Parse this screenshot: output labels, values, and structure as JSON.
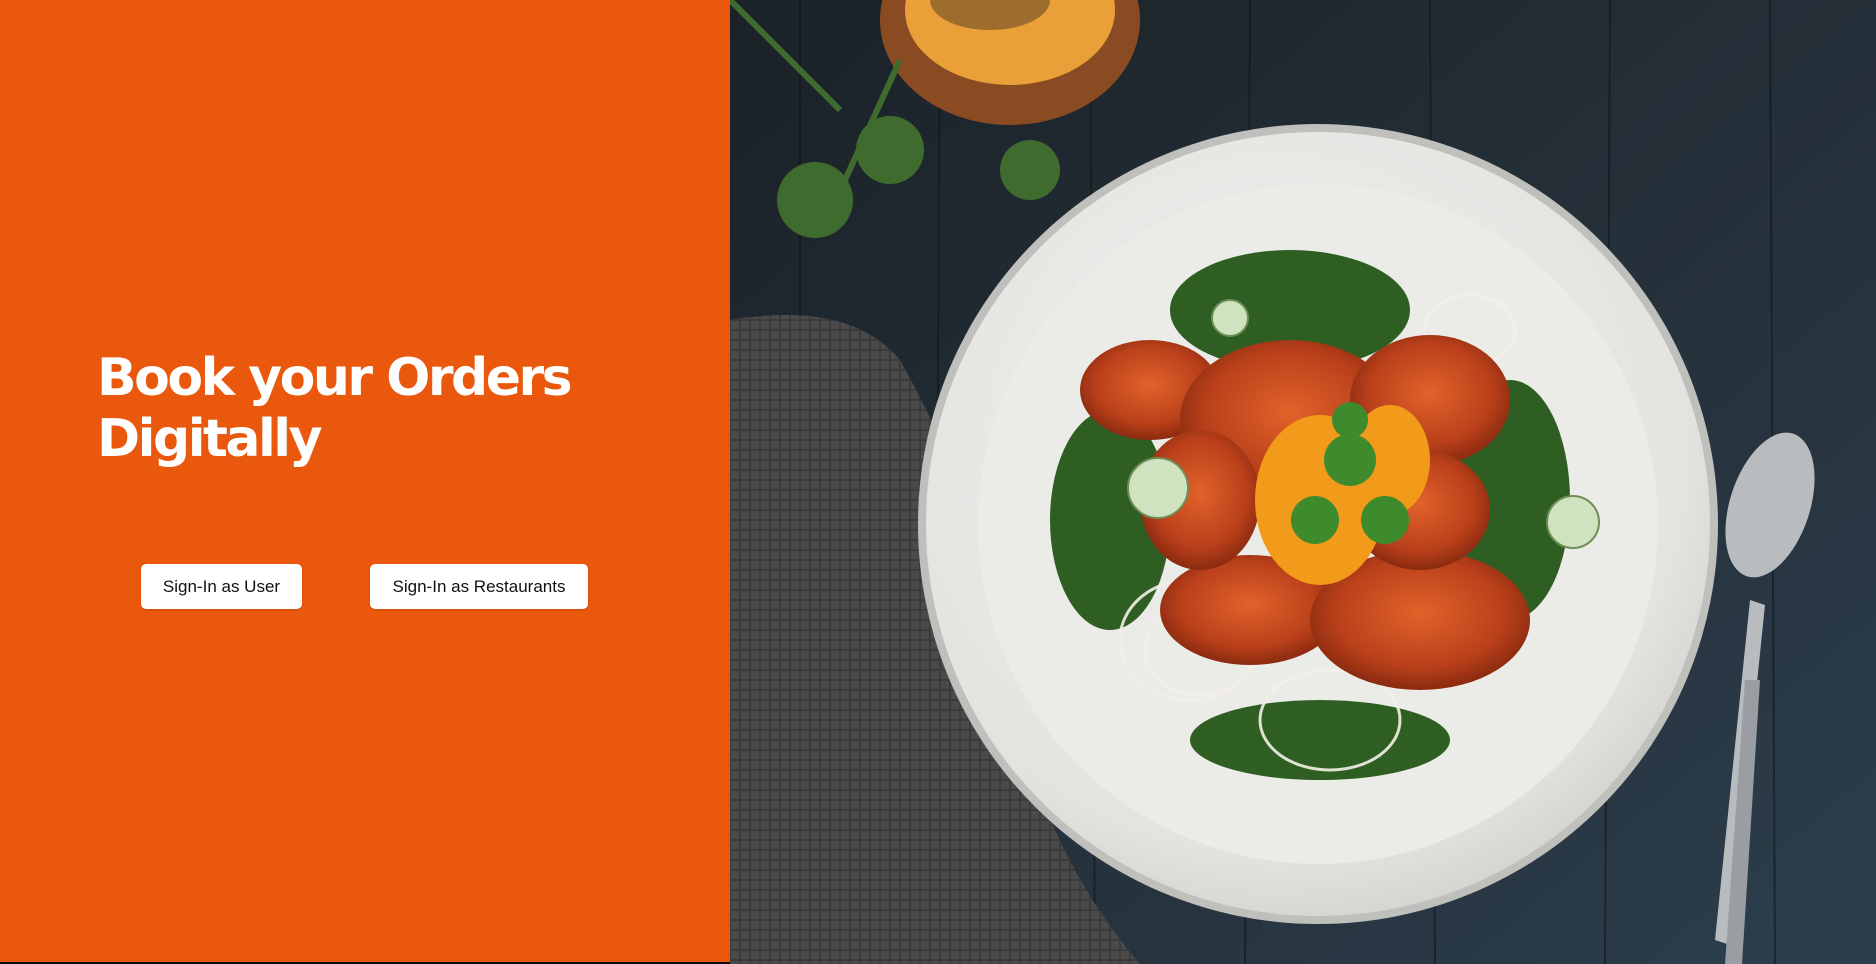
{
  "hero": {
    "headline_line1": "Book your Orders",
    "headline_line2": "Digitally"
  },
  "actions": {
    "sign_in_user": "Sign-In as User",
    "sign_in_restaurants": "Sign-In as Restaurants"
  },
  "colors": {
    "brand_orange": "#e9580c",
    "button_bg": "#ffffff",
    "button_text": "#111111"
  },
  "image": {
    "subject": "food-photo-plate-of-spicy-chicken-salad"
  }
}
